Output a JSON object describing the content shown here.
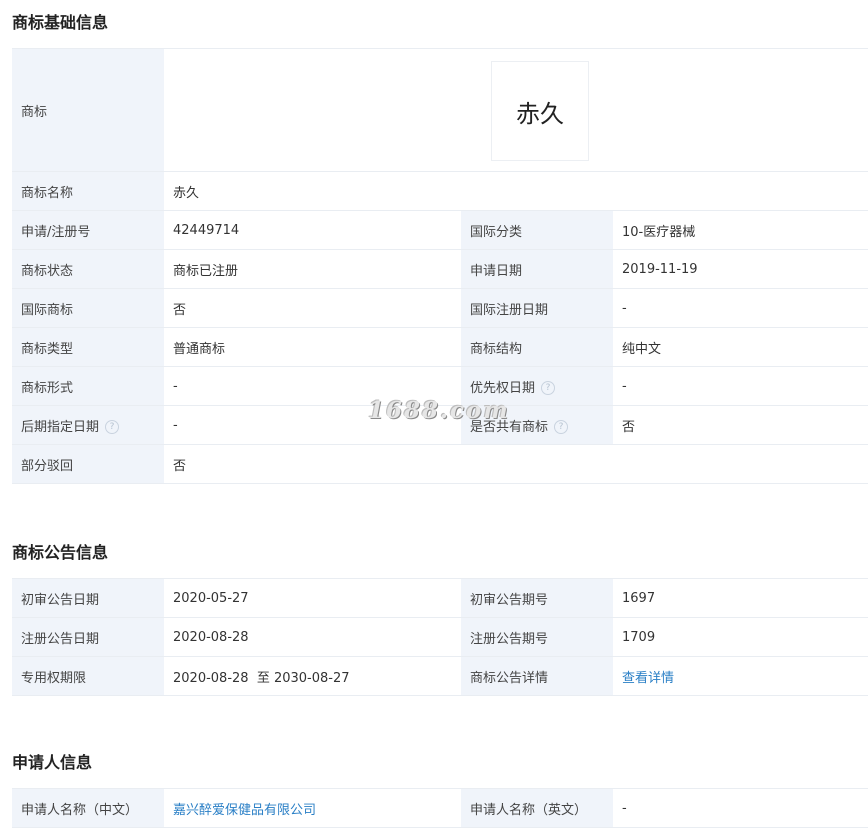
{
  "basic": {
    "title": "商标基础信息",
    "logo_label": "商标",
    "logo_text": "赤久",
    "name_label": "商标名称",
    "name_value": "赤久",
    "reg_no_label": "申请/注册号",
    "reg_no_value": "42449714",
    "intl_class_label": "国际分类",
    "intl_class_value": "10-医疗器械",
    "status_label": "商标状态",
    "status_value": "商标已注册",
    "apply_date_label": "申请日期",
    "apply_date_value": "2019-11-19",
    "intl_mark_label": "国际商标",
    "intl_mark_value": "否",
    "intl_reg_date_label": "国际注册日期",
    "intl_reg_date_value": "-",
    "type_label": "商标类型",
    "type_value": "普通商标",
    "structure_label": "商标结构",
    "structure_value": "纯中文",
    "form_label": "商标形式",
    "form_value": "-",
    "priority_date_label": "优先权日期",
    "priority_date_value": "-",
    "later_date_label": "后期指定日期",
    "later_date_value": "-",
    "shared_label": "是否共有商标",
    "shared_value": "否",
    "partial_reject_label": "部分驳回",
    "partial_reject_value": "否"
  },
  "announce": {
    "title": "商标公告信息",
    "prelim_date_label": "初审公告日期",
    "prelim_date_value": "2020-05-27",
    "prelim_issue_label": "初审公告期号",
    "prelim_issue_value": "1697",
    "reg_date_label": "注册公告日期",
    "reg_date_value": "2020-08-28",
    "reg_issue_label": "注册公告期号",
    "reg_issue_value": "1709",
    "exclusive_label": "专用权期限",
    "exclusive_value": "2020-08-28  至 2030-08-27",
    "detail_label": "商标公告详情",
    "detail_link": "查看详情"
  },
  "applicant": {
    "title": "申请人信息",
    "name_cn_label": "申请人名称（中文）",
    "name_cn_value": "嘉兴醉爱保健品有限公司",
    "name_en_label": "申请人名称（英文）",
    "name_en_value": "-"
  },
  "watermark": "1688.com",
  "help_icon_glyph": "?"
}
